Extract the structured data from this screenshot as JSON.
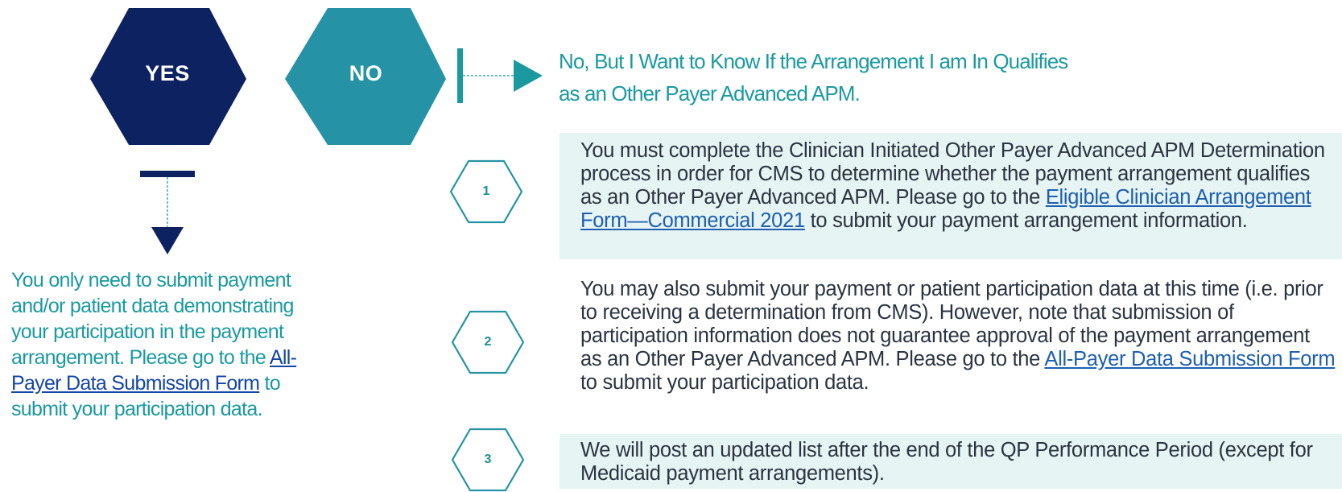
{
  "yes_hexagon": {
    "label": "YES",
    "color": "#0d2260"
  },
  "no_hexagon": {
    "label": "NO",
    "color": "#2593a5"
  },
  "no_branch": {
    "heading_line1": "No, But I Want to Know If the Arrangement I am In Qualifies",
    "heading_line2": "as an Other Payer Advanced APM."
  },
  "yes_branch": {
    "text_before_link": "You only need to submit payment and/or patient data demonstrating your participation in the payment arrangement. Please go to the ",
    "link_text": "All-Payer Data Submission Form",
    "text_after_link": " to submit your participation data."
  },
  "steps": [
    {
      "number": "1",
      "text_before_link": "You must complete the Clinician Initiated Other Payer Advanced APM Determination process in order for CMS to determine whether the payment arrangement qualifies as an Other Payer Advanced APM. Please go to the ",
      "link_text": "Eligible Clinician Arrangement Form—Commercial 2021",
      "text_after_link": " to submit your payment arrangement information."
    },
    {
      "number": "2",
      "text_before_link": "You may also submit your payment or patient participation data at this time (i.e. prior to receiving a determination from CMS). However, note that submission of participation information does not guarantee approval of the payment arrangement as an Other Payer Advanced APM. Please go to the ",
      "link_text": "All-Payer Data Submission Form",
      "text_after_link": " to submit your participation data."
    },
    {
      "number": "3",
      "text": "We will post an updated list after the end of the QP Performance Period (except for Medicaid payment arrangements)."
    }
  ],
  "colors": {
    "navy": "#0d2260",
    "teal": "#2593a5",
    "teal_text": "#1a9aa0",
    "link": "#1e5fb0",
    "box_shade": "#e7f4f4"
  }
}
